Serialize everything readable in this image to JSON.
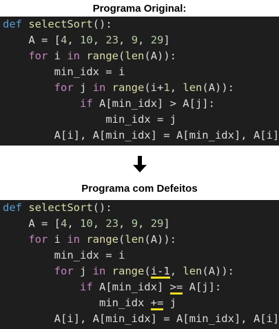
{
  "headings": {
    "original": "Programa Original:",
    "defects": "Programa com Defeitos"
  },
  "arrow_icon": "down-arrow-icon",
  "colors": {
    "background": "#1e1e1e",
    "keyword": "#569cd6",
    "control": "#c586c0",
    "function": "#dcdcaa",
    "number": "#b5cea8",
    "text": "#dcdcdc",
    "highlight": "#f0e020"
  },
  "original": {
    "l1": {
      "kw": "def",
      "name": " selectSort",
      "rest": "():"
    },
    "l2": {
      "indent": "    ",
      "a": "A = [",
      "n1": "4",
      "c1": ", ",
      "n2": "10",
      "c2": ", ",
      "n3": "23",
      "c3": ", ",
      "n4": "9",
      "c4": ", ",
      "n5": "29",
      "end": "]"
    },
    "l3": {
      "indent": "    ",
      "for": "for",
      "mid": " i ",
      "in": "in",
      "sp": " ",
      "range": "range",
      "p1": "(",
      "len": "len",
      "rest": "(A)):"
    },
    "l4": {
      "indent": "        ",
      "text": "min_idx = i"
    },
    "l5": {
      "indent": "        ",
      "for": "for",
      "mid": " j ",
      "in": "in",
      "sp": " ",
      "range": "range",
      "p1": "(i+",
      "n": "1",
      "p2": ", ",
      "len": "len",
      "rest": "(A)):"
    },
    "l6": {
      "indent": "            ",
      "if": "if",
      "rest": " A[min_idx] > A[j]:"
    },
    "l7": {
      "indent": "                ",
      "text": "min_idx = j"
    },
    "l8": {
      "indent": "        ",
      "text": "A[i], A[min_idx] = A[min_idx], A[i]"
    }
  },
  "defects": {
    "l1": {
      "kw": "def",
      "name": " selectSort",
      "rest": "():"
    },
    "l2": {
      "indent": "    ",
      "a": "A = [",
      "n1": "4",
      "c1": ", ",
      "n2": "10",
      "c2": ", ",
      "n3": "23",
      "c3": ", ",
      "n4": "9",
      "c4": ", ",
      "n5": "29",
      "end": "]"
    },
    "l3": {
      "indent": "    ",
      "for": "for",
      "mid": " i ",
      "in": "in",
      "sp": " ",
      "range": "range",
      "p1": "(",
      "len": "len",
      "rest": "(A)):"
    },
    "l4": {
      "indent": "        ",
      "text": "min_idx = i"
    },
    "l5": {
      "indent": "        ",
      "for": "for",
      "mid": " j ",
      "in": "in",
      "sp": " ",
      "range": "range",
      "p1": "(",
      "mark": "i-1",
      "n": "",
      "p2": ", ",
      "len": "len",
      "rest": "(A)):"
    },
    "l6": {
      "indent": "            ",
      "if": "if",
      "pre": " A[min_idx] ",
      "mark": ">=",
      "rest": " A[j]:"
    },
    "l7": {
      "indent": "               ",
      "pre": "min_idx ",
      "mark": "+=",
      "rest": " j"
    },
    "l8": {
      "indent": "        ",
      "text": "A[i], A[min_idx] = A[min_idx], A[i]"
    }
  }
}
